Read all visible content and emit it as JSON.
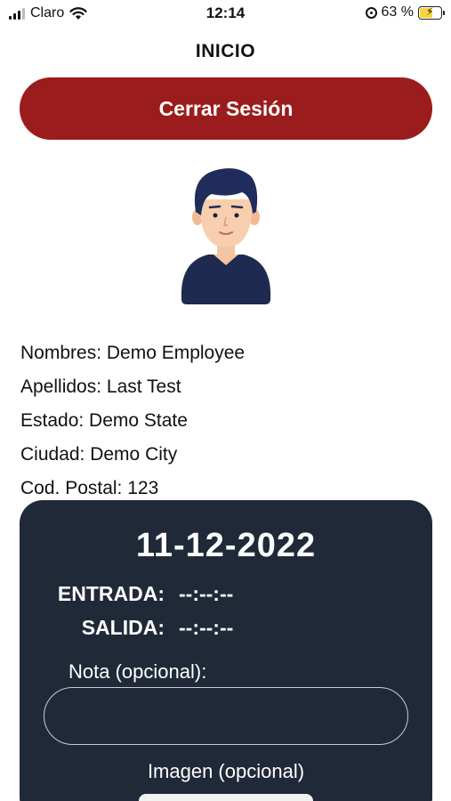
{
  "status_bar": {
    "carrier": "Claro",
    "time": "12:14",
    "battery": "63 %",
    "battery_level": 0.63
  },
  "header": {
    "title": "INICIO"
  },
  "logout": {
    "label": "Cerrar Sesión"
  },
  "profile": {
    "avatar_icon": "employee-avatar",
    "lines": [
      "Nombres: Demo Employee",
      "Apellidos: Last Test",
      "Estado: Demo State",
      "Ciudad: Demo City",
      "Cod. Postal: 123"
    ]
  },
  "attendance": {
    "date": "11-12-2022",
    "entrada_label": "ENTRADA:",
    "entrada_value": "--:--:--",
    "salida_label": "SALIDA:",
    "salida_value": "--:--:--",
    "note_label": "Nota (opcional):",
    "note_value": "",
    "image_label": "Imagen (opcional)"
  },
  "colors": {
    "logout_bg": "#9b1c1c",
    "card_bg": "#202938"
  }
}
